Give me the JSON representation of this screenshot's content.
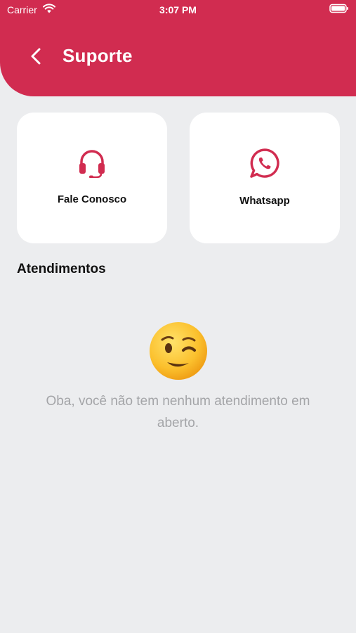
{
  "status_bar": {
    "carrier": "Carrier",
    "time": "3:07 PM"
  },
  "header": {
    "title": "Suporte",
    "back_icon": "chevron-left-icon",
    "background_color": "#d12c50"
  },
  "cards": [
    {
      "label": "Fale Conosco",
      "icon": "headset-icon",
      "icon_color": "#d12c50"
    },
    {
      "label": "Whatsapp",
      "icon": "whatsapp-icon",
      "icon_color": "#d12c50"
    }
  ],
  "section": {
    "title": "Atendimentos"
  },
  "empty_state": {
    "emoji": "winking-face-icon",
    "message": "Oba, você não tem nenhum atendimento em aberto."
  }
}
